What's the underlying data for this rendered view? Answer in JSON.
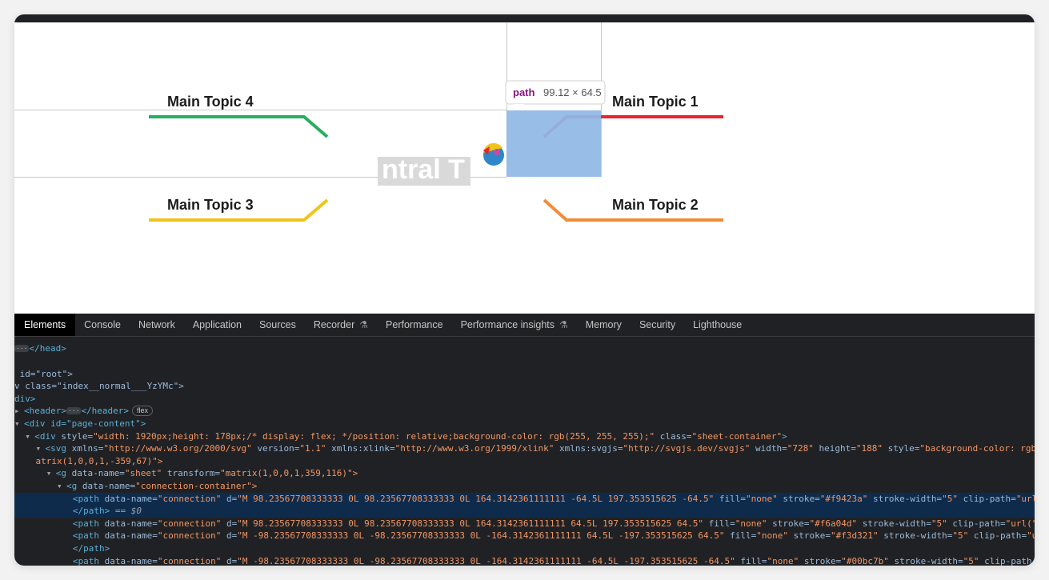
{
  "mindmap": {
    "central_label": "ntral T",
    "topics": [
      {
        "label": "Main Topic 4",
        "color": "#27ae60"
      },
      {
        "label": "Main Topic 1",
        "color": "#e8262b"
      },
      {
        "label": "Main Topic 3",
        "color": "#f0c419"
      },
      {
        "label": "Main Topic 2",
        "color": "#f28c38"
      }
    ],
    "highlight_color": "#8fb8e6"
  },
  "tooltip": {
    "tag": "path",
    "dims": "99.12 × 64.5"
  },
  "devtools": {
    "tabs": [
      "Elements",
      "Console",
      "Network",
      "Application",
      "Sources",
      "Recorder",
      "Performance",
      "Performance insights",
      "Memory",
      "Security",
      "Lighthouse"
    ],
    "active_tab": "Elements"
  },
  "dom": {
    "head_close": "</head>",
    "root_div": "id=\"root\">",
    "div_class": "v class=\"index__normal___YzYMc\">",
    "div_line": "div>",
    "header_open": "<header>",
    "header_close": "</header>",
    "flex_badge": "flex",
    "page_content": "<div id=\"page-content\">",
    "sheet_open": "<div",
    "sheet_style_attr": "style",
    "sheet_style_val": "\"width: 1920px;height: 178px;/* display: flex; */position: relative;background-color: rgb(255, 255, 255);\"",
    "sheet_class_attr": "class",
    "sheet_class_val": "\"sheet-container\"",
    "svg_tag": "<svg",
    "svg_xmlns_attr": "xmlns",
    "svg_xmlns_val": "\"http://www.w3.org/2000/svg\"",
    "svg_version_attr": "version",
    "svg_version_val": "\"1.1\"",
    "svg_xlink_attr": "xmlns:xlink",
    "svg_xlink_val": "\"http://www.w3.org/1999/xlink\"",
    "svg_svgjs_attr": "xmlns:svgjs",
    "svg_svgjs_val": "\"http://svgjs.dev/svgjs\"",
    "svg_width_attr": "width",
    "svg_width_val": "\"728\"",
    "svg_height_attr": "height",
    "svg_height_val": "\"188\"",
    "svg_style_attr": "style",
    "svg_style_val": "\"background-color: rgb(",
    "svg_cont": "atrix(1,0,0,1,-359,67)\">",
    "g_sheet_tag": "<g",
    "g_sheet_dn_attr": "data-name",
    "g_sheet_dn_val": "\"sheet\"",
    "g_sheet_tf_attr": "transform",
    "g_sheet_tf_val": "\"matrix(1,0,0,1,359,116)\">",
    "g_conn_tag": "<g",
    "g_conn_dn_attr": "data-name",
    "g_conn_dn_val": "\"connection-container\">",
    "path_tag": "<path",
    "dn_attr": "data-name",
    "conn_val": "\"connection\"",
    "d_attr": "d",
    "fill_attr": "fill",
    "fill_val": "\"none\"",
    "stroke_attr": "stroke",
    "sw_attr": "stroke-width",
    "sw_val": "\"5\"",
    "clip_attr": "clip-path",
    "path1_d": "\"M 98.23567708333333 0L 98.23567708333333 0L 164.3142361111111 -64.5L 197.353515625 -64.5\"",
    "path1_stroke": "\"#f9423a\"",
    "path1_clip": "\"url(",
    "path_close": "</path>",
    "dollar": "== $0",
    "path2_d": "\"M 98.23567708333333 0L 98.23567708333333 0L 164.3142361111111 64.5L 197.353515625 64.5\"",
    "path2_stroke": "\"#f6a04d\"",
    "path2_clip": "\"url(\"#",
    "path3_d": "\"M -98.23567708333333 0L -98.23567708333333 0L -164.3142361111111 64.5L -197.353515625 64.5\"",
    "path3_stroke": "\"#f3d321\"",
    "path3_clip": "\"ur",
    "path4_d": "\"M -98.23567708333333 0L -98.23567708333333 0L -164.3142361111111 -64.5L -197.353515625 -64.5\"",
    "path4_stroke": "\"#00bc7b\"",
    "path4_clip": "clip-path"
  }
}
